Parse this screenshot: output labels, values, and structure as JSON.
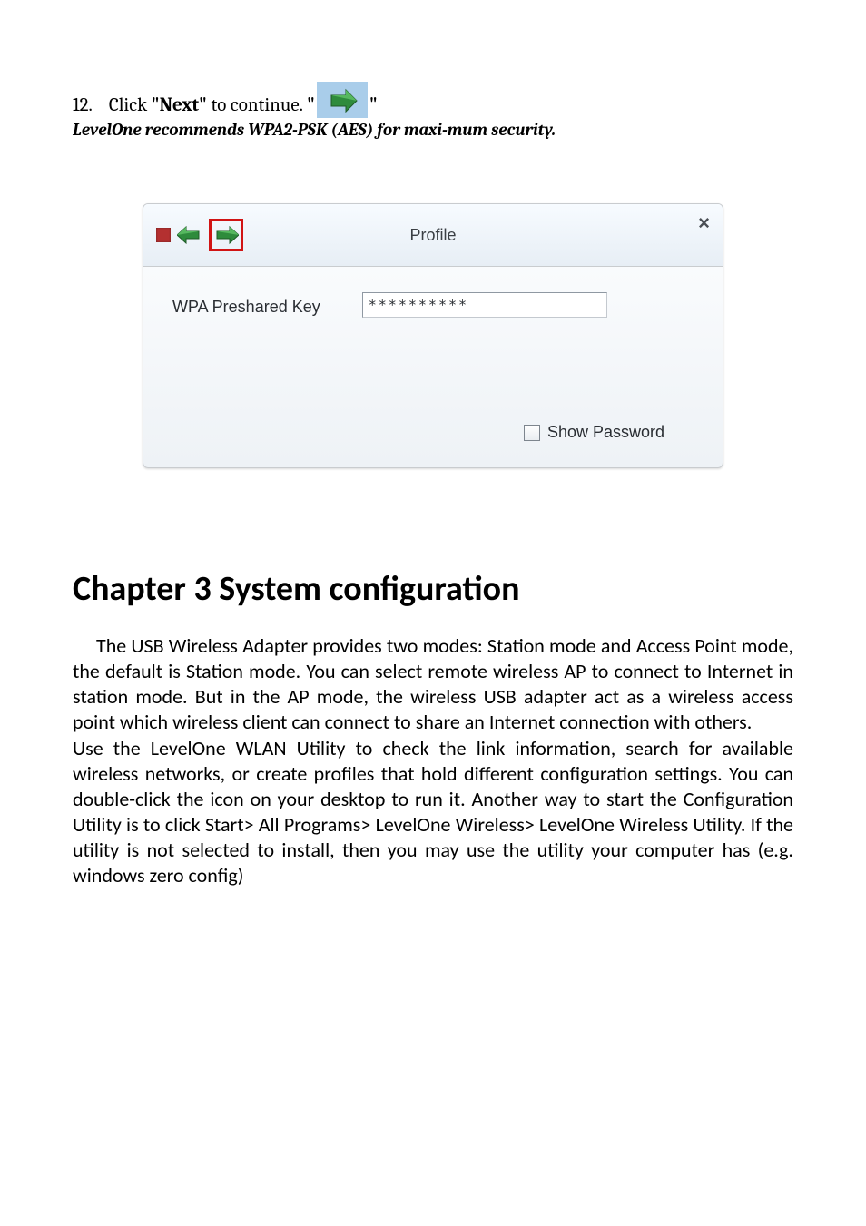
{
  "instruction": {
    "number": "12.",
    "pre_text": "Click ",
    "bold_text": "\"Next\"",
    "post_text": " to continue. ",
    "open_quote": "\"",
    "close_quote": "\""
  },
  "subline": "LevelOne recommends WPA2-PSK (AES) for maxi-mum security.",
  "dialog": {
    "title": "Profile",
    "close_glyph": "×",
    "psk_label": "WPA Preshared Key",
    "psk_value": "**********",
    "show_password_label": "Show Password"
  },
  "chapter_heading": "Chapter 3 System configuration",
  "paragraph1": "The USB Wireless Adapter provides two modes: Station mode and Access Point mode, the default is Station mode. You can select remote wireless AP to connect to Internet in station mode. But in the AP mode, the wireless USB adapter act as a wireless access point which wireless client can connect to share an Internet connection with others.",
  "paragraph2": "Use the LevelOne WLAN Utility to check the link information, search for available wireless networks, or create profiles that hold different configuration settings. You can double-click the icon on your desktop to run it. Another way to start the Configuration Utility is to click Start> All Programs> LevelOne Wireless> LevelOne Wireless Utility. If the utility is not selected to install, then you may use the utility your computer has (e.g. windows zero config)"
}
